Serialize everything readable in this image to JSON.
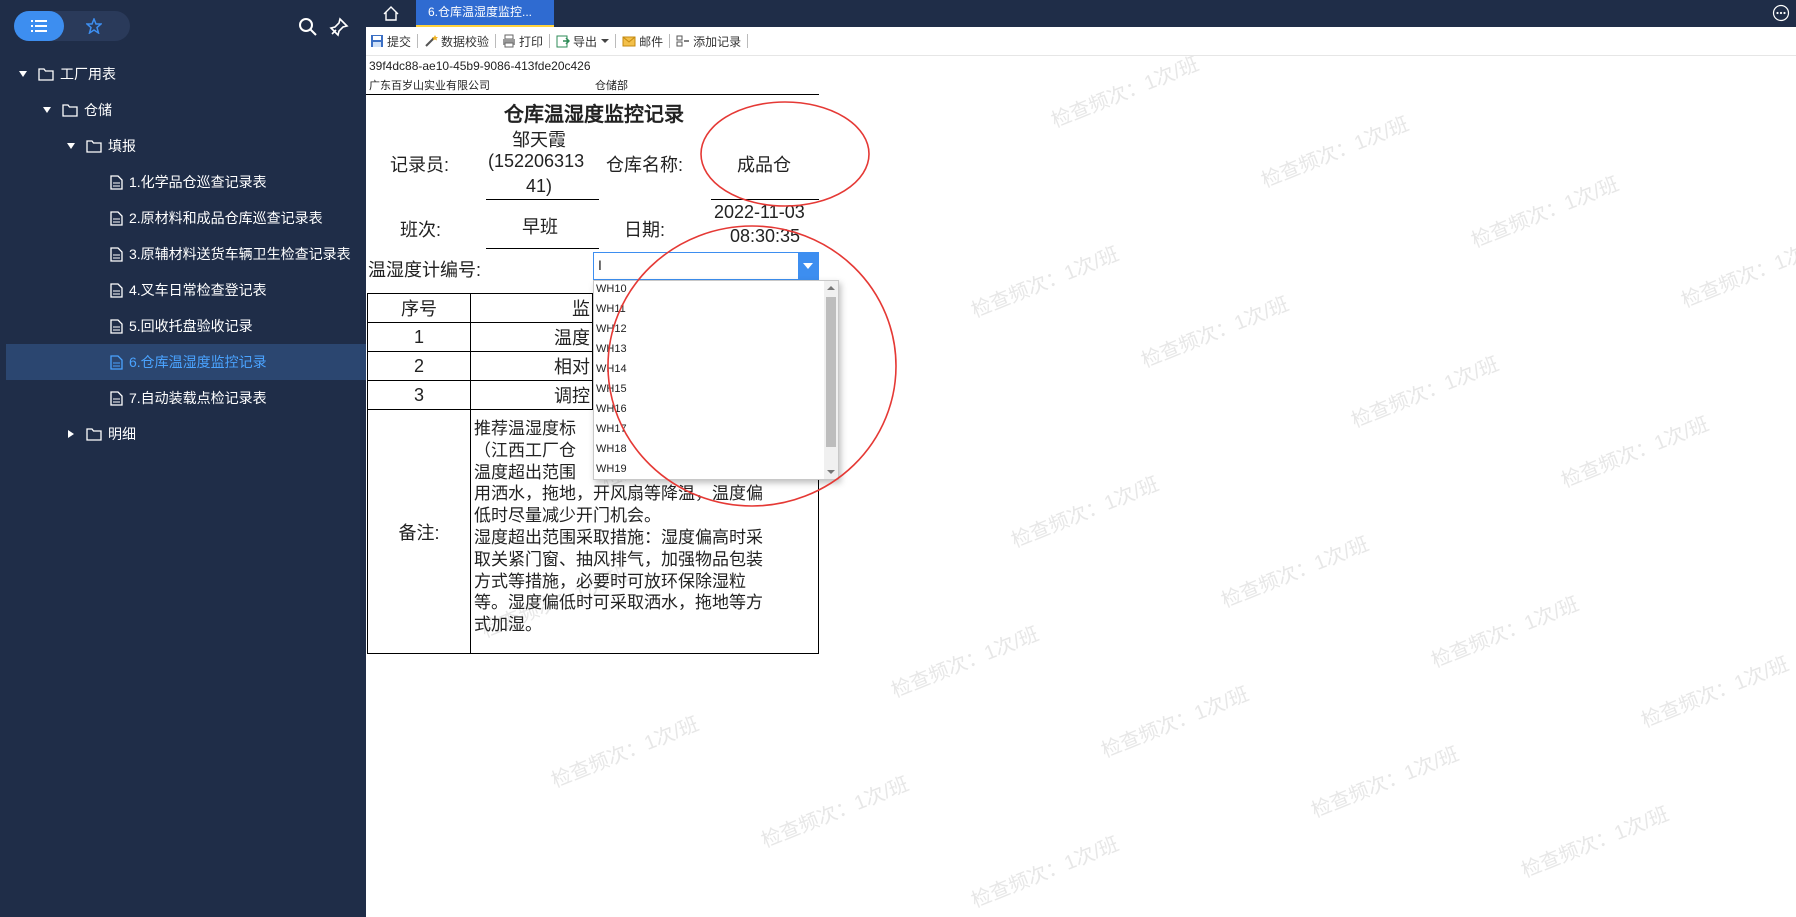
{
  "sidebar": {
    "tree": [
      {
        "label": "工厂用表"
      },
      {
        "label": "仓储"
      },
      {
        "label": "填报"
      },
      {
        "label": "1.化学品仓巡查记录表"
      },
      {
        "label": "2.原材料和成品仓库巡查记录表"
      },
      {
        "label": "3.原辅材料送货车辆卫生检查记录表"
      },
      {
        "label": "4.叉车日常检查登记表"
      },
      {
        "label": "5.回收托盘验收记录"
      },
      {
        "label": "6.仓库温湿度监控记录"
      },
      {
        "label": "7.自动装载点检记录表"
      },
      {
        "label": "明细"
      }
    ]
  },
  "tabs": {
    "active_label": "6.仓库温湿度监控..."
  },
  "toolbar": {
    "submit": "提交",
    "validate": "数据校验",
    "print": "打印",
    "export": "导出",
    "mail": "邮件",
    "add_record": "添加记录"
  },
  "report": {
    "record_id": "39f4dc88-ae10-45b9-9086-413fde20c426",
    "company": "广东百岁山实业有限公司",
    "department": "仓储部",
    "title": "仓库温湿度监控记录",
    "recorder_label": "记录员:",
    "recorder_value_l1": "邹天霞",
    "recorder_value_l2": "(152206313",
    "recorder_value_l3": "41)",
    "warehouse_label": "仓库名称:",
    "warehouse_value": "成品仓",
    "shift_label": "班次:",
    "shift_value": "早班",
    "date_label": "日期:",
    "date_value_l1": "2022-11-03",
    "date_value_l2": "08:30:35",
    "meter_label": "温湿度计编号:",
    "meter_value": "I",
    "table_header_seq": "序号",
    "table_header_item": "监",
    "rows": [
      {
        "seq": "1",
        "item": "温度"
      },
      {
        "seq": "2",
        "item": "相对"
      },
      {
        "seq": "3",
        "item": "调控"
      }
    ],
    "remark_label": "备注:",
    "remark_lines": [
      "推荐温湿度标",
      "（江西工厂仓",
      "温度超出范围",
      "用洒水，拖地，开风扇等降温，温度偏",
      "低时尽量减少开门机会。",
      "湿度超出范围采取措施：湿度偏高时采",
      "取关紧门窗、抽风排气，加强物品包装",
      "方式等措施，必要时可放环保除湿粒",
      "等。湿度偏低时可采取洒水，拖地等方",
      "式加湿。"
    ]
  },
  "dropdown": {
    "options": [
      "WH10",
      "WH11",
      "WH12",
      "WH13",
      "WH14",
      "WH15",
      "WH16",
      "WH17",
      "WH18",
      "WH19"
    ]
  },
  "watermark": {
    "text": "检查频次：1次/班"
  },
  "colors": {
    "sidebar_bg": "#1f2d48",
    "active_blue": "#3d8ef0",
    "annotation_red": "#e53935"
  }
}
